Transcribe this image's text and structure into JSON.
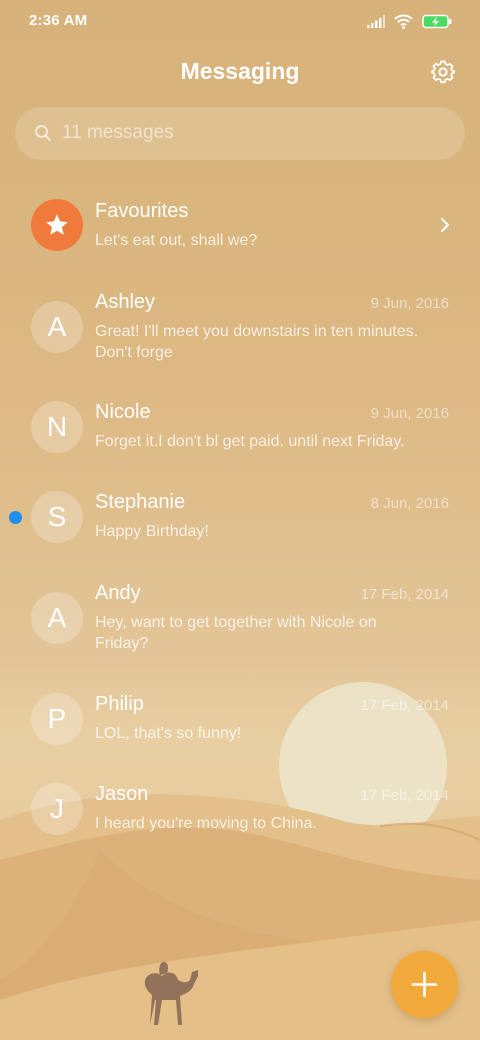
{
  "status_bar": {
    "time": "2:36 AM",
    "icons": [
      "signal-icon",
      "wifi-icon",
      "battery-charging-icon"
    ]
  },
  "header": {
    "title": "Messaging",
    "settings_icon": "gear-icon"
  },
  "search": {
    "placeholder": "11 messages",
    "icon": "search-icon"
  },
  "favourites": {
    "name": "Favourites",
    "preview": "Let's eat out, shall we?",
    "icon": "star-icon"
  },
  "conversations": [
    {
      "initial": "A",
      "name": "Ashley",
      "date": "9 Jun, 2016",
      "preview": "Great! I'll meet you downstairs in ten minutes. Don't forge",
      "unread": false
    },
    {
      "initial": "N",
      "name": "Nicole",
      "date": "9 Jun, 2016",
      "preview": "Forget it.I don't bl get paid. until next Friday.",
      "unread": false
    },
    {
      "initial": "S",
      "name": "Stephanie",
      "date": "8 Jun, 2016",
      "preview": "Happy Birthday!",
      "unread": true
    },
    {
      "initial": "A",
      "name": "Andy",
      "date": "17 Feb, 2014",
      "preview": "Hey, want to get together with Nicole on Friday?",
      "unread": false
    },
    {
      "initial": "P",
      "name": "Philip",
      "date": "17 Feb, 2014",
      "preview": "LOL, that's so funny!",
      "unread": false
    },
    {
      "initial": "J",
      "name": "Jason",
      "date": "17 Feb, 2014",
      "preview": "I heard you're moving to China.",
      "unread": false
    }
  ],
  "fab": {
    "icon": "plus-icon"
  },
  "colors": {
    "accent": "#f1a93b",
    "favourite": "#f07a3b",
    "unread": "#1e8ff0"
  }
}
